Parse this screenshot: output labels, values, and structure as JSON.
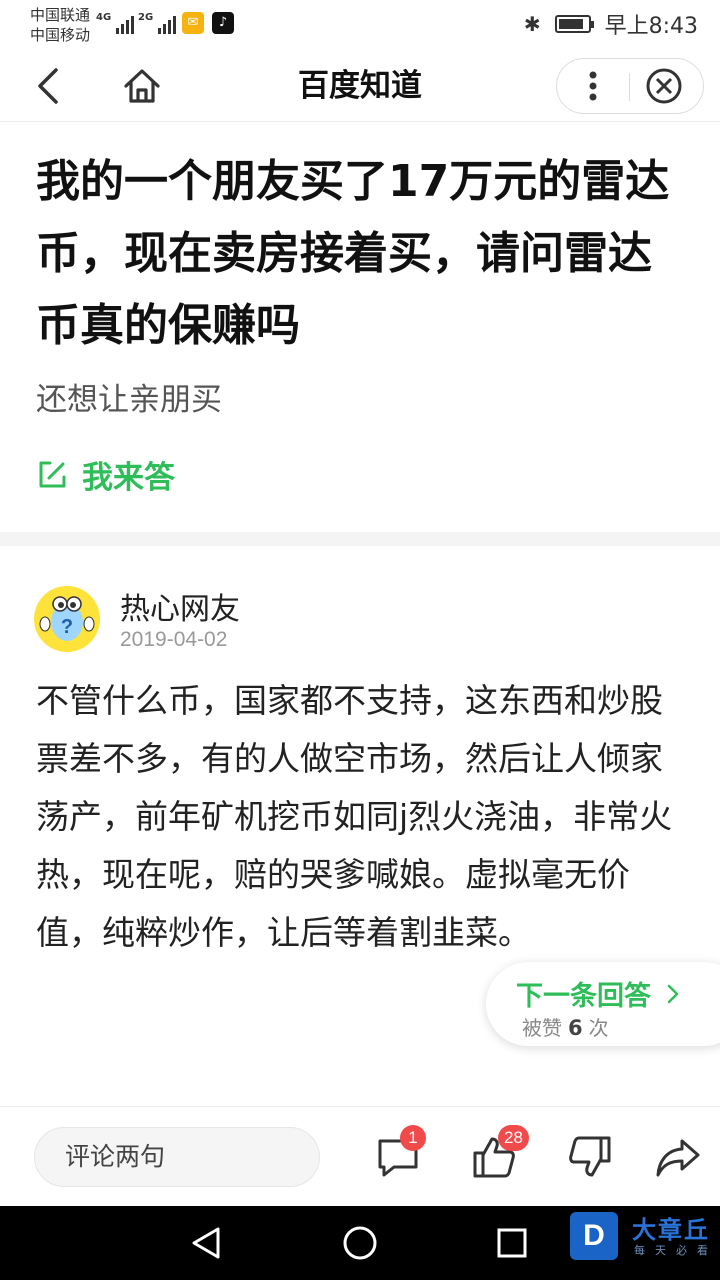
{
  "status_bar": {
    "carrier1": "中国联通",
    "carrier2": "中国移动",
    "net1": "4G",
    "net2": "2G",
    "time": "早上8:43",
    "icons": [
      "signal-icon",
      "mail-app-icon",
      "tiktok-app-icon",
      "bluetooth-icon",
      "battery-icon"
    ]
  },
  "nav": {
    "title": "百度知道",
    "icons": [
      "back-icon",
      "home-icon",
      "more-icon",
      "close-icon"
    ]
  },
  "question": {
    "title": "我的一个朋友买了17万元的雷达币，现在卖房接着买，请问雷达币真的保赚吗",
    "description": "还想让亲朋买",
    "answer_button": "我来答"
  },
  "answer": {
    "user_name": "热心网友",
    "date": "2019-04-02",
    "body": "不管什么币，国家都不支持，这东西和炒股票差不多，有的人做空市场，然后让人倾家荡产，前年矿机挖币如同j烈火浇油，非常火热，现在呢，赔的哭爹喊娘。虚拟毫无价值，纯粹炒作，让后等着割韭菜。"
  },
  "next_answer": {
    "label": "下一条回答",
    "likes_prefix": "被赞",
    "likes_count": "6",
    "likes_suffix": "次"
  },
  "action_bar": {
    "comment_placeholder": "评论两句",
    "comment_count": "1",
    "like_count": "28",
    "icons": [
      "comment-icon",
      "thumbs-up-icon",
      "thumbs-down-icon",
      "share-icon"
    ]
  },
  "watermark": {
    "logo_letter": "D",
    "name": "大章丘",
    "slogan": "每天必看"
  },
  "colors": {
    "accent_green": "#2fbd5a",
    "badge_red": "#f04a4a",
    "watermark_blue": "#1a63c7"
  }
}
